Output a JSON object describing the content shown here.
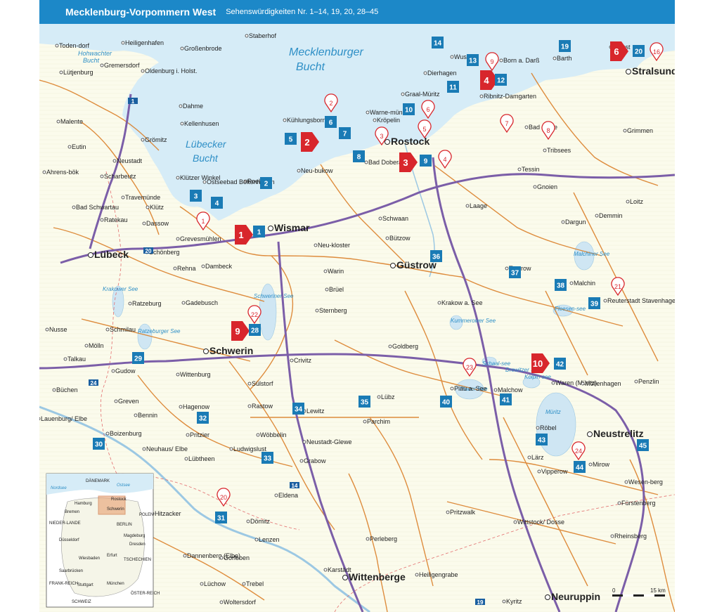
{
  "header": {
    "title": "Mecklenburg-Vorpommern West",
    "subtitle": "Sehenswürdigkeiten Nr. 1–14, 19, 20, 28–45"
  },
  "colors": {
    "water": "#d6ecf7",
    "land": "#fbfbec",
    "road": "#d9791f",
    "autobahn": "#7b5ea8",
    "header": "#1c88c8",
    "marker_blue": "#1a7bb5",
    "marker_red": "#d8262c"
  },
  "seas": [
    {
      "name": "Mecklenburger",
      "italic": true
    },
    {
      "name": "Bucht",
      "italic": true
    },
    {
      "name": "Lübecker",
      "italic": true
    },
    {
      "name": "Bucht",
      "italic": true
    },
    {
      "name": "Hohwachter",
      "italic": true
    },
    {
      "name": "Bucht",
      "italic": true
    }
  ],
  "lakes": [
    "Müritz",
    "Schweriner See",
    "Plauer See",
    "Kölpin-see",
    "Fleesen-see",
    "Malchiner See",
    "Kummerower See",
    "Krakower See",
    "Ratzeburger See",
    "Schaal-see",
    "Drewitzer See"
  ],
  "cities": [
    {
      "name": "Lübeck",
      "bold": true
    },
    {
      "name": "Schwerin",
      "bold": true
    },
    {
      "name": "Rostock",
      "bold": true
    },
    {
      "name": "Wismar",
      "bold": true
    },
    {
      "name": "Stralsund",
      "bold": true
    },
    {
      "name": "Güstrow",
      "bold": true
    },
    {
      "name": "Neustrelitz",
      "bold": true
    },
    {
      "name": "Wittenberge",
      "bold": true
    },
    {
      "name": "Neuruppin",
      "bold": true
    }
  ],
  "towns": [
    "Heiligenhafen",
    "Großenbrode",
    "Staberhof",
    "Toden-dorf",
    "Lütjenburg",
    "Oldenburg i. Holst.",
    "Gremersdorf",
    "Dahme",
    "Malente",
    "Eutin",
    "Grömitz",
    "Kellenhusen",
    "Neustadt",
    "Scharbeutz",
    "Ahrens-bök",
    "Travemünde",
    "Bad Schwartau",
    "Ratekau",
    "Dassow",
    "Klütz",
    "Klützer Winkel",
    "Poel",
    "Ostseebad Boltenhagen",
    "Grevesmühlen",
    "Schönberg",
    "Dambeck",
    "Rehna",
    "Gadebusch",
    "Ratzeburg",
    "Mölln",
    "Nusse",
    "Schmilau",
    "Talkau",
    "Gudow",
    "Büchen",
    "Lauenburg/ Elbe",
    "Boizenburg",
    "Wittenburg",
    "Hagenow",
    "Greven",
    "Bennin",
    "Pritzier",
    "Neuhaus/ Elbe",
    "Lübtheen",
    "Ludwigslust",
    "Neustadt-Glewe",
    "Grabow",
    "Dömitz",
    "Hitzacker",
    "Dannenberg (Elbe)",
    "Lüchow",
    "Trebel",
    "Woltersdorf",
    "Gorleben",
    "Lenzen",
    "Perleberg",
    "Pritzwalk",
    "Wittstock/ Dosse",
    "Kyritz",
    "Rheinsberg",
    "Fürstenberg",
    "Mirow",
    "Wesen-berg",
    "Röbel",
    "Malchow",
    "Waren (Müritz)",
    "Plau a. See",
    "Lübz",
    "Parchim",
    "Goldberg",
    "Crivitz",
    "Sternberg",
    "Brüel",
    "Warin",
    "Neu-kloster",
    "Bützow",
    "Schwaan",
    "Laage",
    "Tessin",
    "Teterow",
    "Malchin",
    "Reuterstadt Stavenhagen",
    "Demmin",
    "Loitz",
    "Grimmen",
    "Ribnitz-Damgarten",
    "Barth",
    "Bad Sülze",
    "Tribsees",
    "Kröpelin",
    "Bad Doberan",
    "Neu-bukow",
    "Kühlungsborn",
    "Warne-münde",
    "Graal-Müritz",
    "Dierhagen",
    "Wustrow",
    "Born a. Darß",
    "Zingst",
    "Gnoien",
    "Dargun",
    "Krakow a. See",
    "Lewitz",
    "Rastow",
    "Sülstorf",
    "Wöbbelin",
    "Eldena",
    "Karstädt",
    "Heiligengrabe",
    "Lärz",
    "Vipperow",
    "Penzlin",
    "Möllenhagen"
  ],
  "markers": {
    "blue": [
      "1",
      "2",
      "3",
      "4",
      "5",
      "6",
      "7",
      "8",
      "9",
      "10",
      "11",
      "12",
      "13",
      "14",
      "19",
      "20",
      "28",
      "29",
      "30",
      "31",
      "32",
      "33",
      "34",
      "35",
      "36",
      "37",
      "38",
      "39",
      "40",
      "41",
      "42",
      "43",
      "44",
      "45"
    ],
    "red": [
      "1",
      "2",
      "3",
      "4",
      "6",
      "9",
      "10"
    ],
    "pin": [
      "1",
      "2",
      "3",
      "4",
      "5",
      "6",
      "7",
      "8",
      "9",
      "16",
      "20",
      "21",
      "22",
      "23",
      "24"
    ]
  },
  "autobahn_labels": [
    "1",
    "20",
    "24",
    "14",
    "19"
  ],
  "inset": {
    "labels": [
      "Nordsee",
      "Ostsee",
      "DÄNEMARK",
      "Rostock",
      "Hamburg",
      "Schwerin",
      "Bremen",
      "BERLIN",
      "NIEDER-LANDE",
      "POLEN",
      "Magdeburg",
      "Düsseldorf",
      "Dresden",
      "Wiesbaden",
      "Erfurt",
      "TSCHECHIEN",
      "Saarbrücken",
      "FRANK-REICH",
      "Stuttgart",
      "München",
      "SCHWEIZ",
      "ÖSTER-REICH"
    ]
  },
  "scalebar": {
    "min": "0",
    "max": "15 km"
  }
}
